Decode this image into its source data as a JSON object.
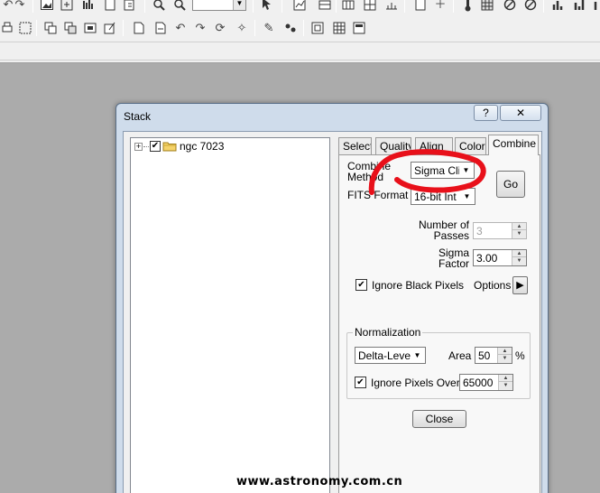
{
  "dialog": {
    "title": "Stack",
    "help_label": "?",
    "close_label": "✕"
  },
  "tree": {
    "expand_glyph": "+",
    "check_glyph": "✔",
    "item_label": "ngc 7023"
  },
  "tabs": [
    {
      "label": "Select"
    },
    {
      "label": "Quality"
    },
    {
      "label": "Align"
    },
    {
      "label": "Color"
    },
    {
      "label": "Combine"
    }
  ],
  "combine": {
    "method_label_line1": "Combine",
    "method_label_line2": "Method",
    "method_value": "Sigma Clip",
    "go_label": "Go",
    "fits_label": "FITS Format",
    "fits_value": "16-bit Int",
    "passes_label_line1": "Number of",
    "passes_label_line2": "Passes",
    "passes_value": "3",
    "sigma_label_line1": "Sigma",
    "sigma_label_line2": "Factor",
    "sigma_value": "3.00",
    "ignore_black_label": "Ignore Black Pixels",
    "ignore_black_checked": true,
    "options_label": "Options",
    "options_arrow": "▶",
    "normalization_title": "Normalization",
    "normalization_value": "Delta-Level",
    "area_label": "Area",
    "area_value": "50",
    "area_unit": "%",
    "ignore_over_label": "Ignore Pixels Over",
    "ignore_over_checked": true,
    "ignore_over_value": "65000",
    "close_label": "Close"
  },
  "glyphs": {
    "check": "✔",
    "dropdown": "▼",
    "spin_up": "▲",
    "spin_down": "▼"
  },
  "watermark": "www.astronomy.com.cn",
  "colors": {
    "dialog_frame": "#cfdceb",
    "annotation_red": "#e8101a",
    "workspace": "#ababab"
  },
  "icons": {
    "toolbar_row1": [
      "undo-icon",
      "redo-icon",
      "image-icon",
      "fit-icon",
      "histogram-icon",
      "new-doc-icon",
      "doc-edit-icon",
      "zoom-in-icon",
      "zoom-out-icon",
      "pointer-help-icon",
      "chart-icon",
      "layers-icon",
      "layers-icon",
      "ruler-icon",
      "page-icon",
      "plus-icon",
      "thermometer-icon",
      "grid-icon",
      "no-entry-icon",
      "no-entry-icon",
      "bars-icon",
      "bars-icon"
    ],
    "toolbar_row2": [
      "print-icon",
      "select-icon",
      "move-icon",
      "copy-icon",
      "paste-icon",
      "page-icon",
      "page-icon",
      "undo-icon",
      "redo-icon",
      "rotate-icon",
      "magic-icon",
      "pencil-icon",
      "points-icon",
      "align-icon",
      "grid-icon",
      "calc-icon"
    ]
  }
}
